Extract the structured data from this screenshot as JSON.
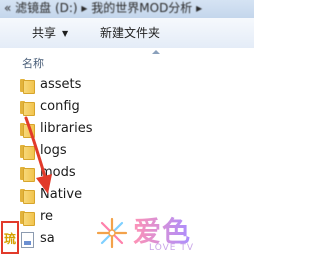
{
  "window": {
    "title_path": "« 滤镜盘 (D:) ▸ 我的世界MOD分析 ▸"
  },
  "toolbar": {
    "share_label": "共享",
    "share_caret": "▼",
    "new_folder_label": "新建文件夹"
  },
  "list_header": {
    "name_label": "名称"
  },
  "files": [
    {
      "name": "assets",
      "icon": "folder-icon"
    },
    {
      "name": "config",
      "icon": "folder-icon"
    },
    {
      "name": "libraries",
      "icon": "folder-icon"
    },
    {
      "name": "logs",
      "icon": "folder-icon"
    },
    {
      "name": "mods",
      "icon": "folder-icon"
    },
    {
      "name": "Native",
      "icon": "folder-icon"
    },
    {
      "name": "re",
      "icon": "folder-icon"
    },
    {
      "name": "sa",
      "icon": "file-icon"
    }
  ],
  "overlay": {
    "box_char": "琉",
    "watermark_cn": "爱色",
    "watermark_en": "LOVE TV",
    "annotation_color": "#e23a2a"
  }
}
